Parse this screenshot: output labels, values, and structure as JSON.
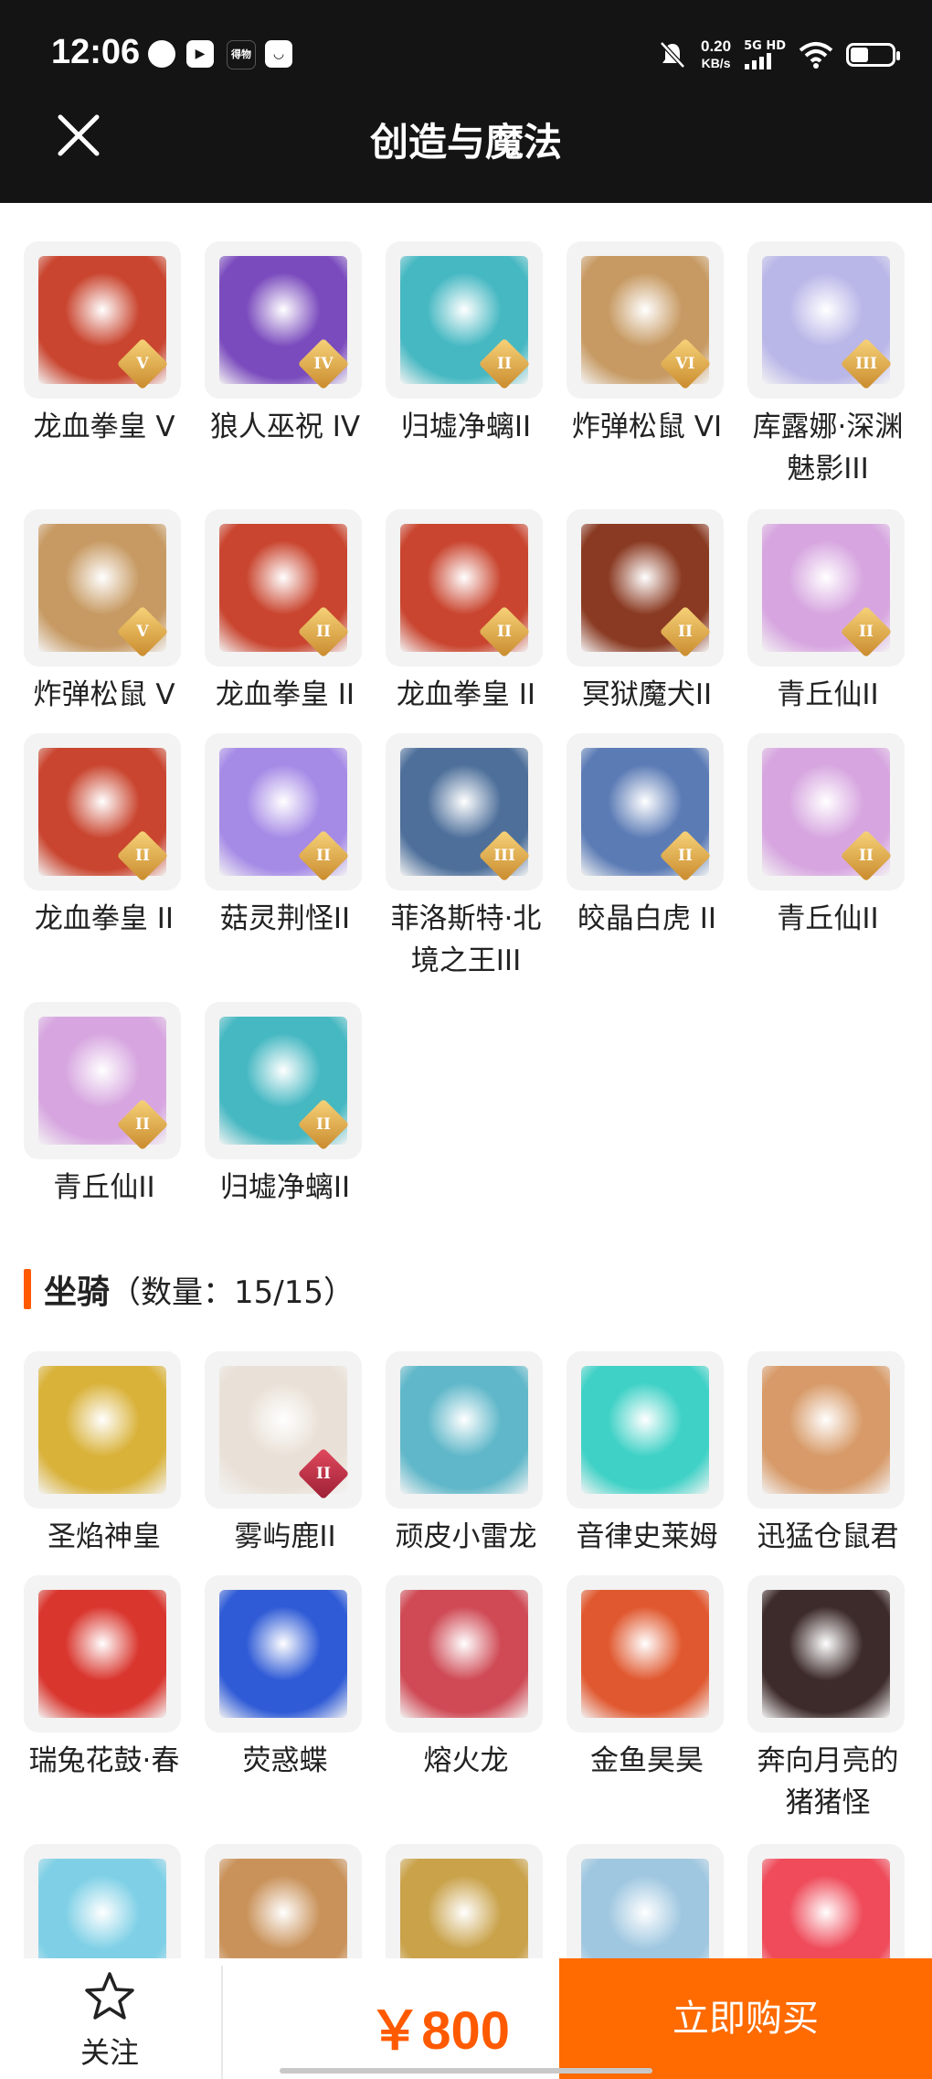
{
  "status_bar": {
    "time": "12:06",
    "app_icons": [
      "netease-icon",
      "media-icon",
      "text-badge-icon",
      "message-icon"
    ],
    "small_badge_text": "得物",
    "net_speed_value": "0.20",
    "net_speed_unit": "KB/s",
    "network": "5G HD",
    "icons": [
      "mute-icon",
      "signal-icon",
      "wifi-icon",
      "battery-icon"
    ]
  },
  "header": {
    "title": "创造与魔法",
    "close_icon": "close-icon"
  },
  "pets": {
    "items": [
      {
        "name": "龙血拳皇 V",
        "badge": "V",
        "color": "#c9452f"
      },
      {
        "name": "狼人巫祝 IV",
        "badge": "IV",
        "color": "#7a4bbd"
      },
      {
        "name": "归墟净螭II",
        "badge": "II",
        "color": "#46b8c2"
      },
      {
        "name": "炸弹松鼠 VI",
        "badge": "VI",
        "color": "#c79a63"
      },
      {
        "name": "库露娜·深渊魅影III",
        "badge": "III",
        "color": "#b9b6e8"
      },
      {
        "name": "炸弹松鼠 V",
        "badge": "V",
        "color": "#c79a63"
      },
      {
        "name": "龙血拳皇 II",
        "badge": "II",
        "color": "#c9452f"
      },
      {
        "name": "龙血拳皇 II",
        "badge": "II",
        "color": "#c9452f"
      },
      {
        "name": "冥狱魔犬II",
        "badge": "II",
        "color": "#8a3a22"
      },
      {
        "name": "青丘仙II",
        "badge": "II",
        "color": "#d7a6e0"
      },
      {
        "name": "龙血拳皇 II",
        "badge": "II",
        "color": "#c9452f"
      },
      {
        "name": "菇灵荆怪II",
        "badge": "II",
        "color": "#a58ae6"
      },
      {
        "name": "菲洛斯特·北境之王III",
        "badge": "III",
        "color": "#4d6f9a"
      },
      {
        "name": "皎晶白虎 II",
        "badge": "II",
        "color": "#5b7bb5"
      },
      {
        "name": "青丘仙II",
        "badge": "II",
        "color": "#d7a6e0"
      },
      {
        "name": "青丘仙II",
        "badge": "II",
        "color": "#d7a6e0"
      },
      {
        "name": "归墟净螭II",
        "badge": "II",
        "color": "#46b8c2"
      }
    ]
  },
  "mounts": {
    "section_title": "坐骑",
    "count_label": "（数量：15/15）",
    "items": [
      {
        "name": "圣焰神皇",
        "badge": "",
        "color": "#d9b23a"
      },
      {
        "name": "雾屿鹿II",
        "badge": "II",
        "color": "#e9e1d7"
      },
      {
        "name": "顽皮小雷龙",
        "badge": "",
        "color": "#5fb7c9"
      },
      {
        "name": "音律史莱姆",
        "badge": "",
        "color": "#3fd1c6"
      },
      {
        "name": "迅猛仓鼠君",
        "badge": "",
        "color": "#d79a68"
      },
      {
        "name": "瑞兔花鼓·春",
        "badge": "",
        "color": "#d9362e"
      },
      {
        "name": "荧惑蝶",
        "badge": "",
        "color": "#2f5bd6"
      },
      {
        "name": "熔火龙",
        "badge": "",
        "color": "#cf4a55"
      },
      {
        "name": "金鱼昊昊",
        "badge": "",
        "color": "#e0582f"
      },
      {
        "name": "奔向月亮的猪猪怪",
        "badge": "",
        "color": "#3d2a2a"
      },
      {
        "name": "",
        "badge": "",
        "color": "#7fd0e6"
      },
      {
        "name": "",
        "badge": "",
        "color": "#c9925a"
      },
      {
        "name": "",
        "badge": "",
        "color": "#c9a24a"
      },
      {
        "name": "",
        "badge": "",
        "color": "#9fc7e0"
      },
      {
        "name": "",
        "badge": "",
        "color": "#ef4b5a"
      }
    ]
  },
  "bottom_bar": {
    "follow_label": "关注",
    "follow_icon": "star-outline-icon",
    "price": "￥800",
    "buy_label": "立即购买",
    "accent": "#ff6b00"
  }
}
